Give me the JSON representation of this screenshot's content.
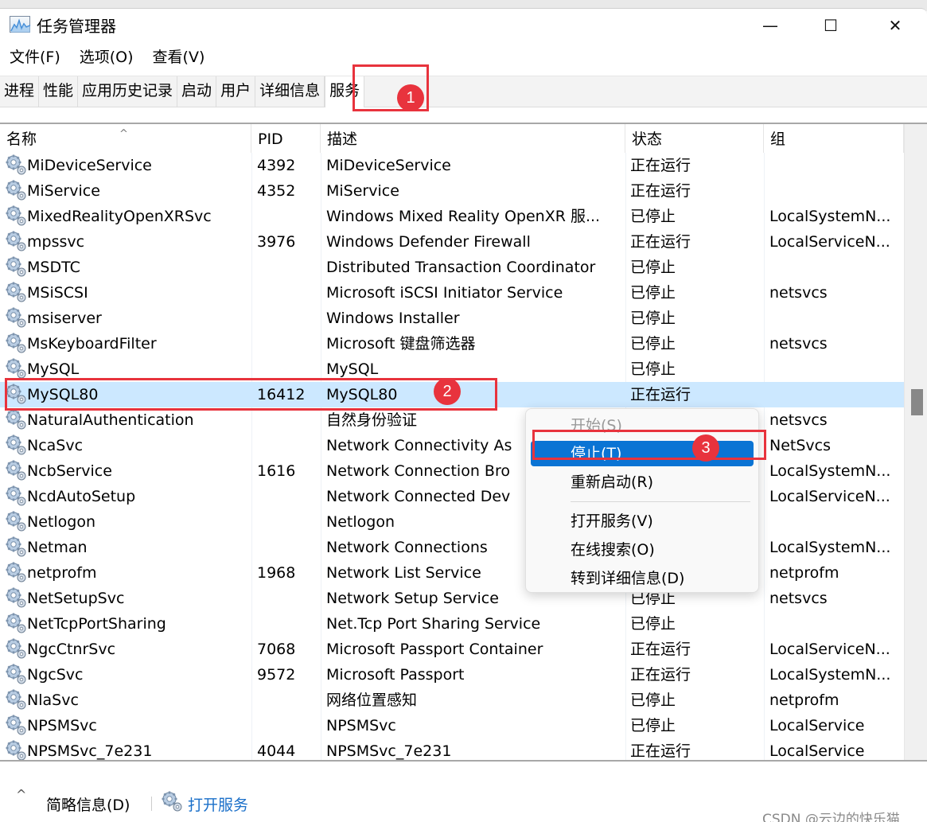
{
  "window": {
    "title": "任务管理器",
    "controls": {
      "minimize": "—",
      "maximize": "☐",
      "close": "✕"
    }
  },
  "menubar": [
    {
      "label": "文件(F)"
    },
    {
      "label": "选项(O)"
    },
    {
      "label": "查看(V)"
    }
  ],
  "tabs": [
    {
      "label": "进程",
      "active": false
    },
    {
      "label": "性能",
      "active": false
    },
    {
      "label": "应用历史记录",
      "active": false
    },
    {
      "label": "启动",
      "active": false
    },
    {
      "label": "用户",
      "active": false
    },
    {
      "label": "详细信息",
      "active": false
    },
    {
      "label": "服务",
      "active": true
    }
  ],
  "table": {
    "sort_indicator": "^",
    "columns": [
      {
        "key": "name",
        "label": "名称"
      },
      {
        "key": "pid",
        "label": "PID"
      },
      {
        "key": "desc",
        "label": "描述"
      },
      {
        "key": "status",
        "label": "状态"
      },
      {
        "key": "group",
        "label": "组"
      }
    ],
    "rows": [
      {
        "name": "MiDeviceService",
        "pid": "4392",
        "desc": "MiDeviceService",
        "status": "正在运行",
        "group": ""
      },
      {
        "name": "MiService",
        "pid": "4352",
        "desc": "MiService",
        "status": "正在运行",
        "group": ""
      },
      {
        "name": "MixedRealityOpenXRSvc",
        "pid": "",
        "desc": "Windows Mixed Reality OpenXR 服...",
        "status": "已停止",
        "group": "LocalSystemN..."
      },
      {
        "name": "mpssvc",
        "pid": "3976",
        "desc": "Windows Defender Firewall",
        "status": "正在运行",
        "group": "LocalServiceN..."
      },
      {
        "name": "MSDTC",
        "pid": "",
        "desc": "Distributed Transaction Coordinator",
        "status": "已停止",
        "group": ""
      },
      {
        "name": "MSiSCSI",
        "pid": "",
        "desc": "Microsoft iSCSI Initiator Service",
        "status": "已停止",
        "group": "netsvcs"
      },
      {
        "name": "msiserver",
        "pid": "",
        "desc": "Windows Installer",
        "status": "已停止",
        "group": ""
      },
      {
        "name": "MsKeyboardFilter",
        "pid": "",
        "desc": "Microsoft 键盘筛选器",
        "status": "已停止",
        "group": "netsvcs"
      },
      {
        "name": "MySQL",
        "pid": "",
        "desc": "MySQL",
        "status": "已停止",
        "group": ""
      },
      {
        "name": "MySQL80",
        "pid": "16412",
        "desc": "MySQL80",
        "status": "正在运行",
        "group": "",
        "selected": true
      },
      {
        "name": "NaturalAuthentication",
        "pid": "",
        "desc": "自然身份验证",
        "status": "",
        "group": "netsvcs"
      },
      {
        "name": "NcaSvc",
        "pid": "",
        "desc": "Network Connectivity As",
        "status": "",
        "group": "NetSvcs"
      },
      {
        "name": "NcbService",
        "pid": "1616",
        "desc": "Network Connection Bro",
        "status": "",
        "group": "LocalSystemN..."
      },
      {
        "name": "NcdAutoSetup",
        "pid": "",
        "desc": "Network Connected Dev",
        "status": "",
        "group": "LocalServiceN..."
      },
      {
        "name": "Netlogon",
        "pid": "",
        "desc": "Netlogon",
        "status": "",
        "group": ""
      },
      {
        "name": "Netman",
        "pid": "",
        "desc": "Network Connections",
        "status": "",
        "group": "LocalSystemN..."
      },
      {
        "name": "netprofm",
        "pid": "1968",
        "desc": "Network List Service",
        "status": "",
        "group": "netprofm"
      },
      {
        "name": "NetSetupSvc",
        "pid": "",
        "desc": "Network Setup Service",
        "status": "已停止",
        "group": "netsvcs"
      },
      {
        "name": "NetTcpPortSharing",
        "pid": "",
        "desc": "Net.Tcp Port Sharing Service",
        "status": "已停止",
        "group": ""
      },
      {
        "name": "NgcCtnrSvc",
        "pid": "7068",
        "desc": "Microsoft Passport Container",
        "status": "正在运行",
        "group": "LocalServiceN..."
      },
      {
        "name": "NgcSvc",
        "pid": "9572",
        "desc": "Microsoft Passport",
        "status": "正在运行",
        "group": "LocalSystemN..."
      },
      {
        "name": "NlaSvc",
        "pid": "",
        "desc": "网络位置感知",
        "status": "已停止",
        "group": "netprofm"
      },
      {
        "name": "NPSMSvc",
        "pid": "",
        "desc": "NPSMSvc",
        "status": "已停止",
        "group": "LocalService"
      },
      {
        "name": "NPSMSvc_7e231",
        "pid": "4044",
        "desc": "NPSMSvc_7e231",
        "status": "正在运行",
        "group": "LocalService"
      }
    ]
  },
  "context_menu": {
    "items": [
      {
        "label": "开始(S)",
        "state": "disabled"
      },
      {
        "label": "停止(T)",
        "state": "active"
      },
      {
        "label": "重新启动(R)",
        "state": "normal"
      },
      {
        "label": "打开服务(V)",
        "state": "normal"
      },
      {
        "label": "在线搜索(O)",
        "state": "normal"
      },
      {
        "label": "转到详细信息(D)",
        "state": "normal"
      }
    ]
  },
  "annotations": [
    {
      "number": "1"
    },
    {
      "number": "2"
    },
    {
      "number": "3"
    }
  ],
  "footer": {
    "collapse_icon": "^",
    "summary_label": "简略信息(D)",
    "open_services_label": "打开服务"
  },
  "watermark": "CSDN @云边的快乐猫",
  "colors": {
    "selection": "#cce8ff",
    "menu_highlight": "#0a74d4",
    "annotation_red": "#e8333d",
    "link_blue": "#1a6fc9"
  }
}
